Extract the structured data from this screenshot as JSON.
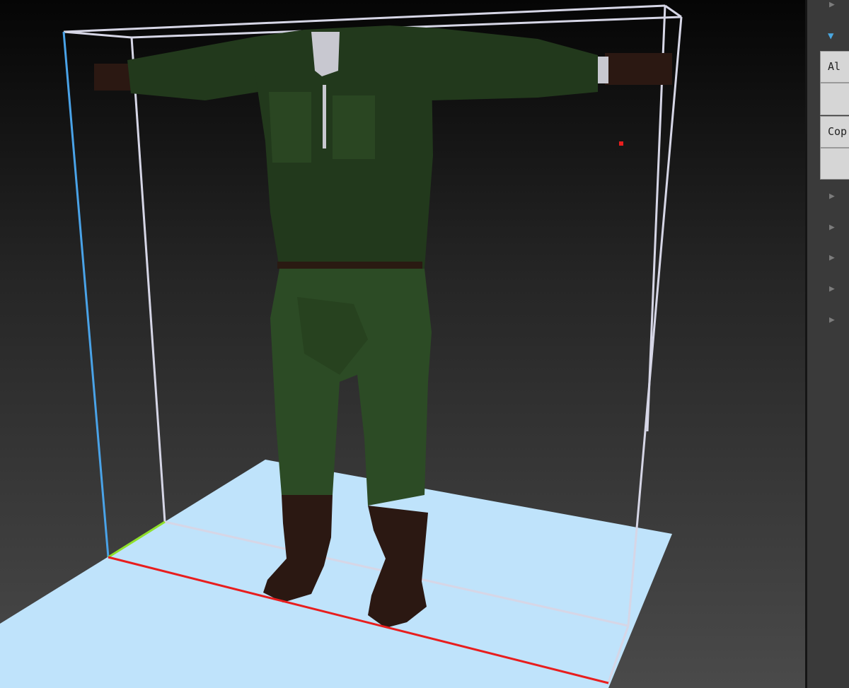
{
  "panel": {
    "section_expanded_label": "",
    "buttons": [
      {
        "label": "Al"
      },
      {
        "label": ""
      },
      {
        "label": "Cop"
      },
      {
        "label": ""
      }
    ],
    "collapsed_items": [
      {
        "label": ""
      },
      {
        "label": ""
      },
      {
        "label": ""
      },
      {
        "label": ""
      },
      {
        "label": ""
      }
    ]
  },
  "viewport": {
    "colors": {
      "floor": "#bfe3fb",
      "outfit_green": "#22391c",
      "outfit_green_light": "#2d4a25",
      "boots": "#2b1812",
      "belt": "#2a1a12",
      "x_axis": "#e81e1e",
      "y_axis": "#8fe02a",
      "z_axis": "#4aa3e8",
      "bounds": "#d6d6e6"
    }
  }
}
